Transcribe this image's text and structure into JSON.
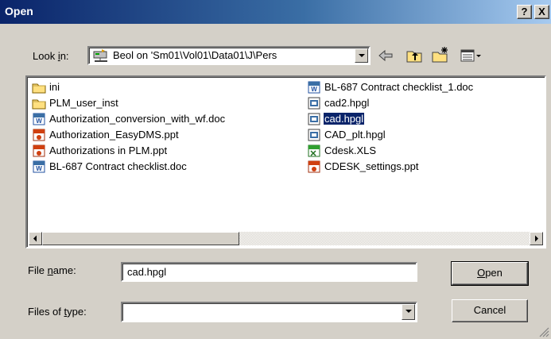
{
  "window": {
    "title": "Open",
    "help_label": "?",
    "close_label": "X"
  },
  "look_in": {
    "label_pre": "Look ",
    "label_u": "i",
    "label_post": "n:",
    "value": "Beol on 'Sm01\\Vol01\\Data01\\J\\Pers"
  },
  "toolbar": {
    "icons": [
      "back-arrow-icon",
      "up-folder-icon",
      "new-folder-icon",
      "view-menu-icon"
    ]
  },
  "files": [
    {
      "name": "ini",
      "icon": "folder-icon"
    },
    {
      "name": "PLM_user_inst",
      "icon": "folder-icon"
    },
    {
      "name": "Authorization_conversion_with_wf.doc",
      "icon": "word-doc-icon"
    },
    {
      "name": "Authorization_EasyDMS.ppt",
      "icon": "powerpoint-icon"
    },
    {
      "name": "Authorizations in PLM.ppt",
      "icon": "powerpoint-icon"
    },
    {
      "name": "BL-687 Contract checklist.doc",
      "icon": "word-doc-icon"
    },
    {
      "name": "BL-687 Contract checklist_1.doc",
      "icon": "word-doc-icon"
    },
    {
      "name": "cad2.hpgl",
      "icon": "hpgl-file-icon"
    },
    {
      "name": "cad.hpgl",
      "icon": "hpgl-file-icon",
      "selected": true
    },
    {
      "name": "CAD_plt.hpgl",
      "icon": "hpgl-file-icon"
    },
    {
      "name": "Cdesk.XLS",
      "icon": "excel-icon"
    },
    {
      "name": "CDESK_settings.ppt",
      "icon": "powerpoint-icon"
    }
  ],
  "file_name": {
    "label_pre": "File ",
    "label_u": "n",
    "label_post": "ame:",
    "value": "cad.hpgl"
  },
  "file_type": {
    "label_pre": "Files of ",
    "label_u": "t",
    "label_post": "ype:",
    "value": ""
  },
  "buttons": {
    "open_u": "O",
    "open_rest": "pen",
    "cancel": "Cancel"
  }
}
